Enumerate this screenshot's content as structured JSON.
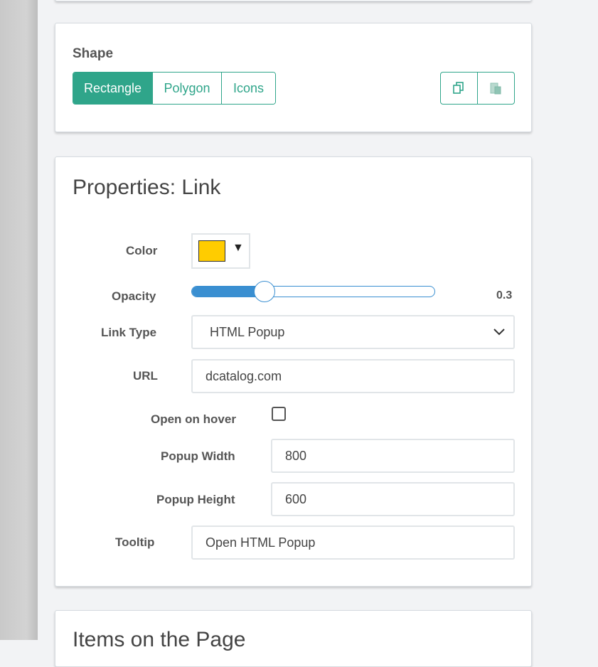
{
  "shape_panel": {
    "title": "Shape",
    "buttons": [
      {
        "label": "Rectangle",
        "active": true
      },
      {
        "label": "Polygon",
        "active": false
      },
      {
        "label": "Icons",
        "active": false
      }
    ],
    "icon_buttons": [
      "copy-icon",
      "paste-icon"
    ]
  },
  "properties": {
    "title": "Properties: Link",
    "color": {
      "label": "Color",
      "value": "#ffcc00",
      "caret": "▼"
    },
    "opacity": {
      "label": "Opacity",
      "value": 0.3,
      "display": "0.3"
    },
    "link_type": {
      "label": "Link Type",
      "value": "HTML Popup"
    },
    "url": {
      "label": "URL",
      "value": "dcatalog.com"
    },
    "open_on_hover": {
      "label": "Open on hover",
      "checked": false
    },
    "popup_width": {
      "label": "Popup Width",
      "value": "800"
    },
    "popup_height": {
      "label": "Popup Height",
      "value": "600"
    },
    "tooltip": {
      "label": "Tooltip",
      "value": "Open HTML Popup"
    }
  },
  "items_panel": {
    "title": "Items on the Page"
  },
  "colors": {
    "accent": "#2fa58a",
    "slider": "#3a8fd1",
    "swatch": "#ffcc00"
  }
}
